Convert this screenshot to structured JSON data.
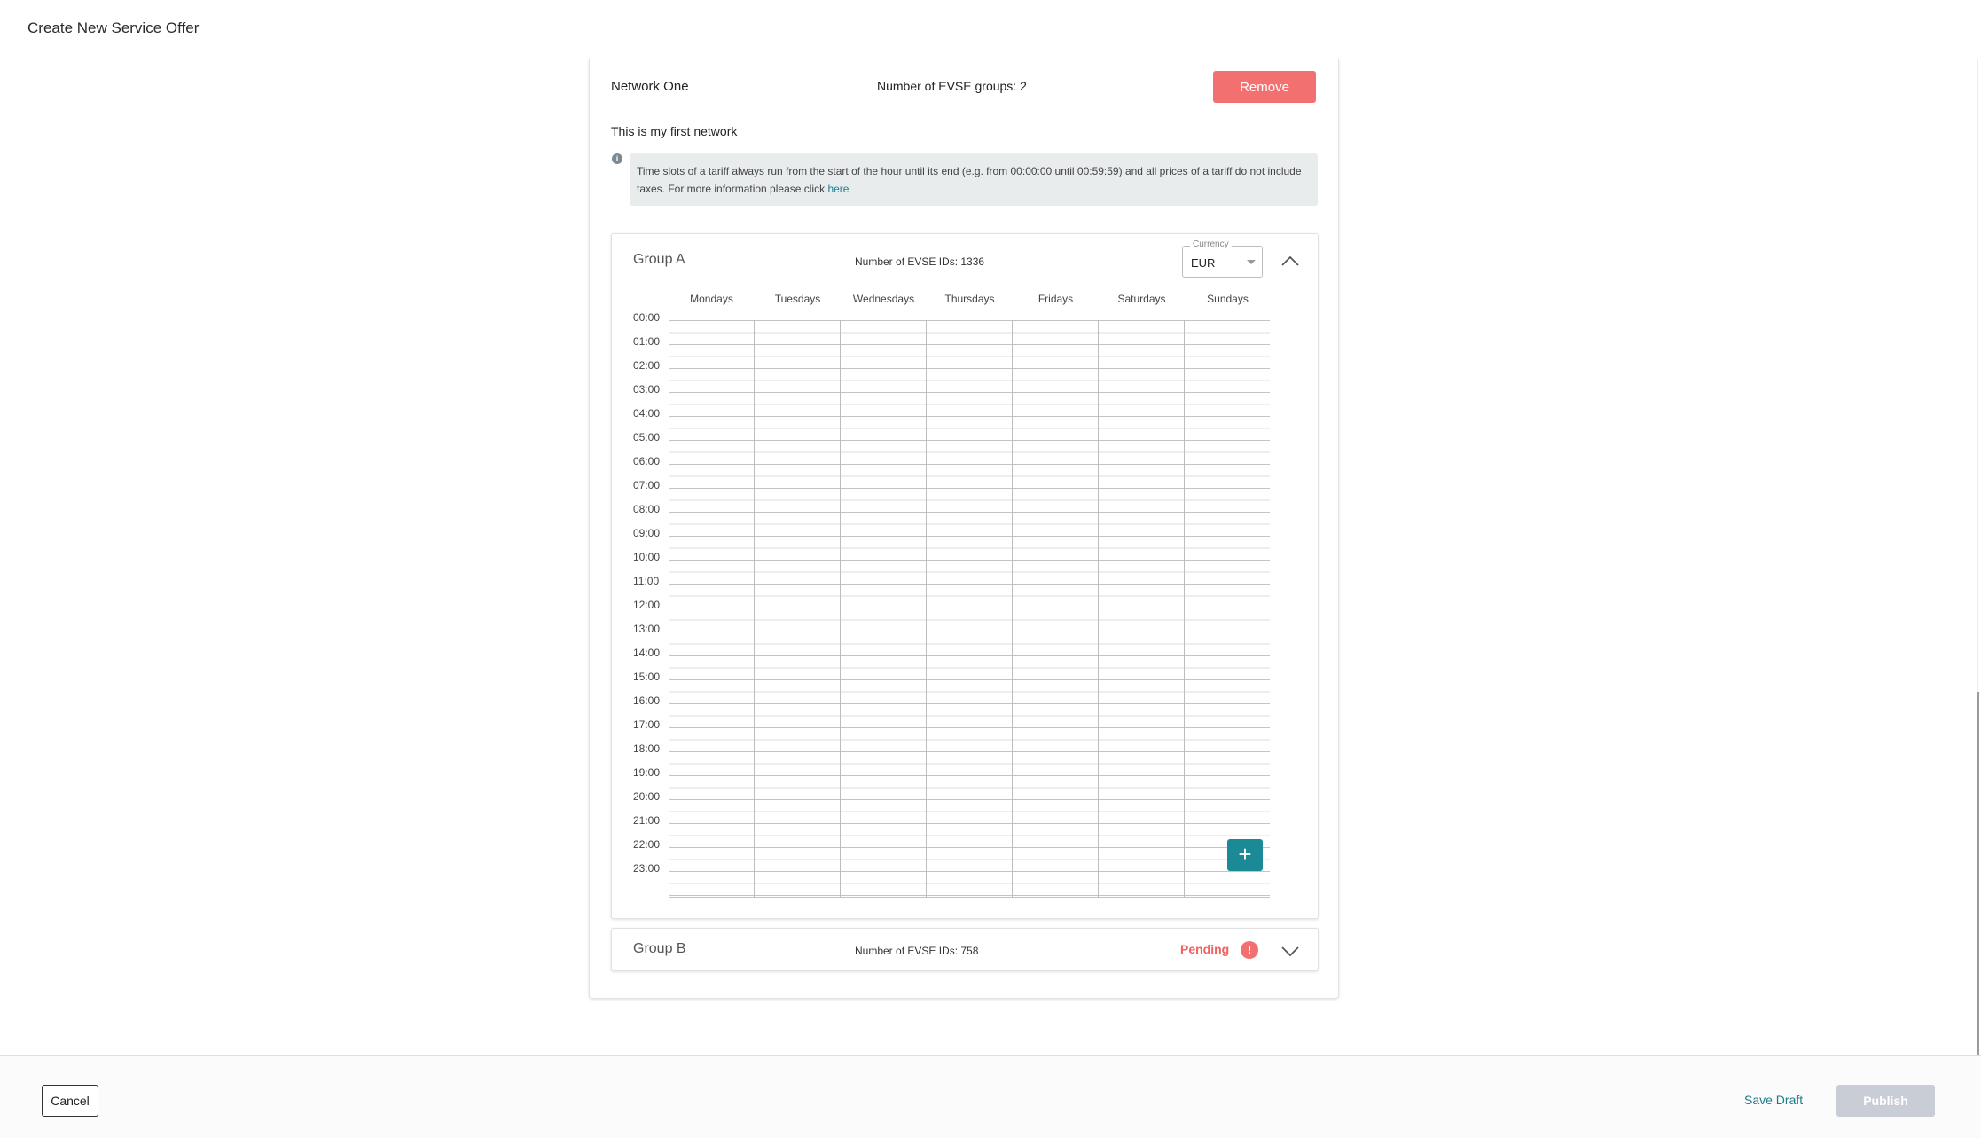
{
  "header": {
    "title": "Create New Service Offer"
  },
  "network": {
    "name": "Network One",
    "groups_count_label": "Number of EVSE groups: 2",
    "remove_label": "Remove",
    "description": "This is my first network",
    "info_text": "Time slots of a tariff always run from the start of the hour until its end (e.g. from 00:00:00 until 00:59:59) and all prices of a tariff do not include taxes. For more information please click",
    "info_link": "here"
  },
  "group_a": {
    "title": "Group A",
    "evse_count_label": "Number of EVSE IDs: 1336",
    "currency_label": "Currency",
    "currency_value": "EUR",
    "days": [
      "Mondays",
      "Tuesdays",
      "Wednesdays",
      "Thursdays",
      "Fridays",
      "Saturdays",
      "Sundays"
    ],
    "hours": [
      "00:00",
      "01:00",
      "02:00",
      "03:00",
      "04:00",
      "05:00",
      "06:00",
      "07:00",
      "08:00",
      "09:00",
      "10:00",
      "11:00",
      "12:00",
      "13:00",
      "14:00",
      "15:00",
      "16:00",
      "17:00",
      "18:00",
      "19:00",
      "20:00",
      "21:00",
      "22:00",
      "23:00"
    ],
    "add_label": "+"
  },
  "group_b": {
    "title": "Group B",
    "evse_count_label": "Number of EVSE IDs: 758",
    "status": "Pending",
    "status_icon": "!"
  },
  "footer": {
    "cancel_label": "Cancel",
    "save_draft_label": "Save Draft",
    "publish_label": "Publish"
  },
  "colors": {
    "remove": "#f37070",
    "accent": "#1b8a96",
    "pending": "#f0625e",
    "publish_disabled": "#c9cdd6"
  }
}
